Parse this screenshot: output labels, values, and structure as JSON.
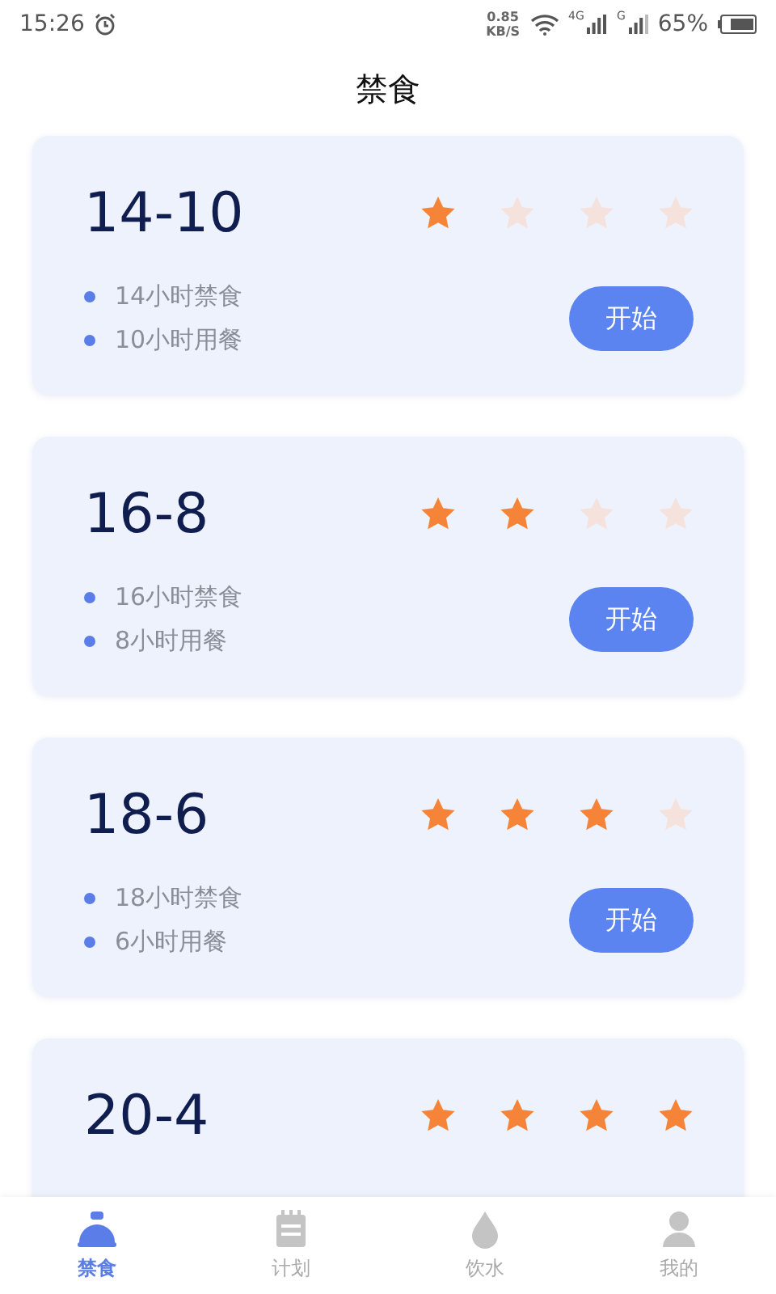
{
  "status_bar": {
    "time": "15:26",
    "speed_value": "0.85",
    "speed_unit": "KB/S",
    "network_1": "4G",
    "network_2": "G",
    "battery": "65%"
  },
  "header": {
    "title": "禁食"
  },
  "plans": [
    {
      "name": "14-10",
      "stars": 1,
      "details": [
        "14小时禁食",
        "10小时用餐"
      ],
      "button": "开始"
    },
    {
      "name": "16-8",
      "stars": 2,
      "details": [
        "16小时禁食",
        "8小时用餐"
      ],
      "button": "开始"
    },
    {
      "name": "18-6",
      "stars": 3,
      "details": [
        "18小时禁食",
        "6小时用餐"
      ],
      "button": "开始"
    },
    {
      "name": "20-4",
      "stars": 4
    }
  ],
  "tab_bar": [
    {
      "label": "禁食",
      "kind": "fast",
      "selected": true
    },
    {
      "label": "计划",
      "kind": "plan",
      "selected": false
    },
    {
      "label": "饮水",
      "kind": "water",
      "selected": false
    },
    {
      "label": "我的",
      "kind": "me",
      "selected": false
    }
  ]
}
